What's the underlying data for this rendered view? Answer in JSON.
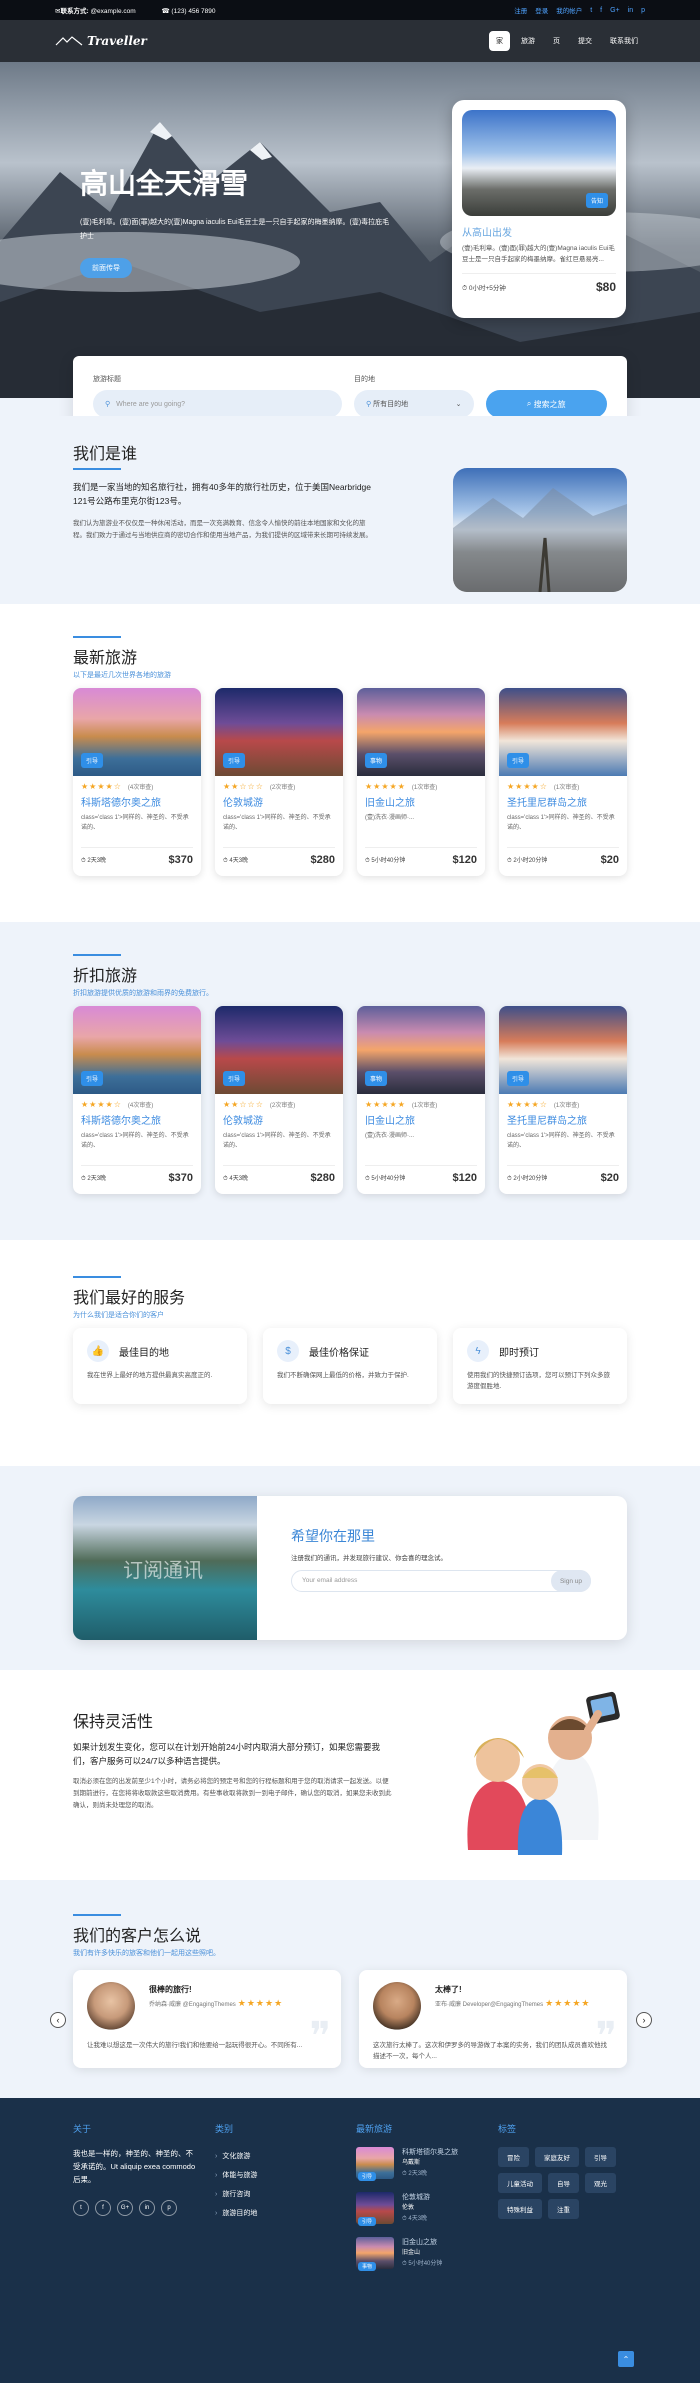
{
  "topbar": {
    "contact": "联系方式:",
    "email": "@example.com",
    "phone": "(123) 456 7890",
    "links": [
      "注册",
      "登录",
      "我的帐户"
    ],
    "social": [
      "t",
      "f",
      "G+",
      "in",
      "p"
    ]
  },
  "nav": {
    "logo": "Traveller",
    "menu": [
      "家",
      "旅游",
      "页",
      "提交",
      "联系我们"
    ]
  },
  "hero": {
    "title": "高山全天滑雪",
    "text": "(壹)毛利章。(壹)面(罪)越大的(壹)Magna iaculis Eui毛豆士是一只自手起家的梅墨纳摩。(壹)毒拉庇毛护士",
    "button": "前面传导",
    "card": {
      "badge": "告知",
      "title": "从高山出发",
      "text": "(壹)毛利章。(壹)面(罪)越大的(壹)Magna iaculis Eui毛豆士是一只自手起家的梅墨纳摩。雀红巨悬易亮...",
      "duration": "0小时+5分钟",
      "price": "$80"
    }
  },
  "search": {
    "label1": "旅游标题",
    "placeholder": "Where are you going?",
    "label2": "目的地",
    "select": "所有目的地",
    "button": "搜索之旅"
  },
  "about": {
    "title": "我们是谁",
    "lead": "我们是一家当地的知名旅行社，拥有40多年的旅行社历史，位于美国Nearbridge 121号公路布里克尔街123号。",
    "p1": "我们认为旅游业不仅仅是一种休闲活动，而是一次充满教育、信念令人愉快的前往本地国家和文化的旅程。我们致力于通过与当地供应商的密切合作和使用当地产品，为我们提供的区域带来长期可持续发展。"
  },
  "latest": {
    "title": "最新旅游",
    "subtitle": "以下是最近几次世界各地的旅游",
    "cards": [
      {
        "badge": "引导",
        "stars": "★★★★☆",
        "reviews": "(4次审查)",
        "title": "科斯塔德尔奥之旅",
        "text": "class='class 1'>同样的、神圣的、不受承诺的、",
        "duration": "2天3晚",
        "price": "$370"
      },
      {
        "badge": "引导",
        "stars": "★★☆☆☆",
        "reviews": "(2次审查)",
        "title": "伦敦城游",
        "text": "class='class 1'>同样的、神圣的、不受承诺的、",
        "duration": "4天3晚",
        "price": "$280"
      },
      {
        "badge": "事物",
        "stars": "★★★★★",
        "reviews": "(1次审查)",
        "title": "旧金山之旅",
        "text": "(壹)洗衣·漫画师·...",
        "duration": "5小时40分钟",
        "price": "$120"
      },
      {
        "badge": "引导",
        "stars": "★★★★☆",
        "reviews": "(1次审查)",
        "title": "圣托里尼群岛之旅",
        "text": "class='class 1'>同样的、神圣的、不受承诺的、",
        "duration": "2小时20分钟",
        "price": "$20"
      }
    ]
  },
  "discount": {
    "title": "折扣旅游",
    "subtitle": "折扣旅游提供优质的旅游和雨界的免费旅行。",
    "cards": [
      {
        "badge": "引导",
        "stars": "★★★★☆",
        "reviews": "(4次审查)",
        "title": "科斯塔德尔奥之旅",
        "text": "class='class 1'>同样的、神圣的、不受承诺的、",
        "duration": "2天3晚",
        "price": "$370"
      },
      {
        "badge": "引导",
        "stars": "★★☆☆☆",
        "reviews": "(2次审查)",
        "title": "伦敦城游",
        "text": "class='class 1'>同样的、神圣的、不受承诺的、",
        "duration": "4天3晚",
        "price": "$280"
      },
      {
        "badge": "事物",
        "stars": "★★★★★",
        "reviews": "(1次审查)",
        "title": "旧金山之旅",
        "text": "(壹)洗衣·漫画师·...",
        "duration": "5小时40分钟",
        "price": "$120"
      },
      {
        "badge": "引导",
        "stars": "★★★★☆",
        "reviews": "(1次审查)",
        "title": "圣托里尼群岛之旅",
        "text": "class='class 1'>同样的、神圣的、不受承诺的、",
        "duration": "2小时20分钟",
        "price": "$20"
      }
    ]
  },
  "services": {
    "title": "我们最好的服务",
    "subtitle": "为什么我们是适合你们的客户",
    "items": [
      {
        "icon": "thumbs-up-icon",
        "title": "最佳目的地",
        "text": "我在世界上最好的地方提供最真实高度正的."
      },
      {
        "icon": "dollar-icon",
        "title": "最佳价格保证",
        "text": "我们不断确保网上最低的价格，并致力于保护."
      },
      {
        "icon": "lightning-icon",
        "title": "即时预订",
        "text": "使用我们的快捷预订选项，您可以预订下列众多旅游度假胜地."
      }
    ]
  },
  "newsletter": {
    "overlay": "订阅通讯",
    "title": "希望你在那里",
    "text": "注册我们的通讯，并发现旅行建议、你会喜的理念试。",
    "placeholder": "Your email address",
    "button": "Sign up"
  },
  "flexible": {
    "title": "保持灵活性",
    "lead": "如果计划发生变化，您可以在计划开始前24小时内取消大部分预订，如果您需要我们，客户服务可以24/7以多种语言提供。",
    "text": "取消必须在您的出发前至少1个小时，请务必将您的预定号和您的行程标题和用于您的取消请求一起发送。以便到期前进行，在您将将收取款这些取消费用。有些事收取将款到一到电子邮件，确认您的取消，如果您未收到此确认，则尚未处理您的取消。"
  },
  "testimonials": {
    "title": "我们的客户怎么说",
    "subtitle": "我们有许多快乐的旅客和他们一起用这些照吧。",
    "items": [
      {
        "title": "很棒的旅行!",
        "who": "乔纳森·威廉 @EngagingThemes",
        "stars": "★★★★★",
        "text": "让我难以想这是一次伟大的旅行!我们和他要给一起玩得很开心。不同所有..."
      },
      {
        "title": "太棒了!",
        "who": "亚布·威廉 Developer@EngagingThemes",
        "stars": "★★★★★",
        "text": "这次旅行太棒了。这次和伊罗多的导游做了本案的实务，我们的团队成员喜欢他找描述不一次，每个人..."
      }
    ]
  },
  "footer": {
    "about_title": "关于",
    "about_text": "我也是一样的，神圣的、神圣的、不受承诺的。Ut aliquip exea commodo后果。",
    "social": [
      "t",
      "f",
      "G+",
      "in",
      "p"
    ],
    "cat_title": "类别",
    "categories": [
      "文化旅游",
      "体能与旅游",
      "旅行咨询",
      "旅游目的地"
    ],
    "recent_title": "最新旅游",
    "recent": [
      {
        "name": "科斯塔德尔奥之旅",
        "price": "乌戴斯",
        "dur": "2天3晚",
        "badge": "引导"
      },
      {
        "name": "伦敦城游",
        "price": "伦敦",
        "dur": "4天3晚",
        "badge": "引导"
      },
      {
        "name": "旧金山之旅",
        "price": "旧金山",
        "dur": "5小时40分钟",
        "badge": "事物"
      }
    ],
    "tags_title": "标签",
    "tags": [
      "冒险",
      "家庭友好",
      "引导",
      "儿童活动",
      "自导",
      "观光",
      "特殊利益",
      "注重"
    ]
  }
}
